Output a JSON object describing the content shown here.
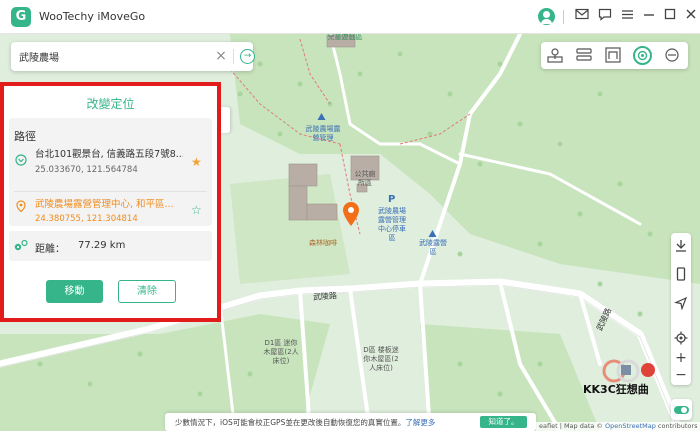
{
  "app": {
    "title": "WooTechy iMoveGo"
  },
  "search": {
    "value": "武陵農場",
    "placeholder": ""
  },
  "panel": {
    "title": "改變定位",
    "route_label": "路徑",
    "origin": {
      "name": "台北101觀景台, 信義路五段7號8...",
      "coords": "25.033670, 121.564784"
    },
    "destination": {
      "name": "武陵農場露營管理中心, 和平區...",
      "coords": "24.380755, 121.304814"
    },
    "distance_label": "距離：",
    "distance_value": "77.29 km",
    "move_button": "移動",
    "clear_button": "清除"
  },
  "map_labels": {
    "playground": "兒童遊戲區",
    "camp_mgmt": "武陵農場露營管理",
    "toilet": "公共廁所區",
    "parking": "武陵農場露營管理中心停車區",
    "camp_area": "武陵露營區",
    "cafe": "森林咖啡",
    "road_main": "武陵路",
    "road_side": "武陵路",
    "zone_d1": "D1區 迷你木屋區(2人床位)",
    "zone_d": "D區 楼板迷你木屋區(2人床位)"
  },
  "notice": {
    "text": "少數情況下，iOS可能會校正GPS並在更改後自動恢復您的真實位置。",
    "link": "了解更多",
    "button": "知道了。"
  },
  "attribution": {
    "prefix": "eaflet | Map data © ",
    "link": "OpenStreetMap",
    "suffix": " contributors"
  },
  "watermark": {
    "text": "KK3C狂想曲"
  },
  "icons": {
    "logo": "app-logo",
    "mail": "mail-icon",
    "feedback": "chat-icon",
    "menu": "menu-icon",
    "minimize": "minimize-icon",
    "maximize": "maximize-icon",
    "close": "close-icon"
  },
  "colors": {
    "accent": "#36b58b",
    "highlight": "#e21b1b",
    "destination": "#f08c1e",
    "map_bg": "#dfeedd",
    "forest": "#c6e2bb",
    "pin": "#f26f1a"
  }
}
